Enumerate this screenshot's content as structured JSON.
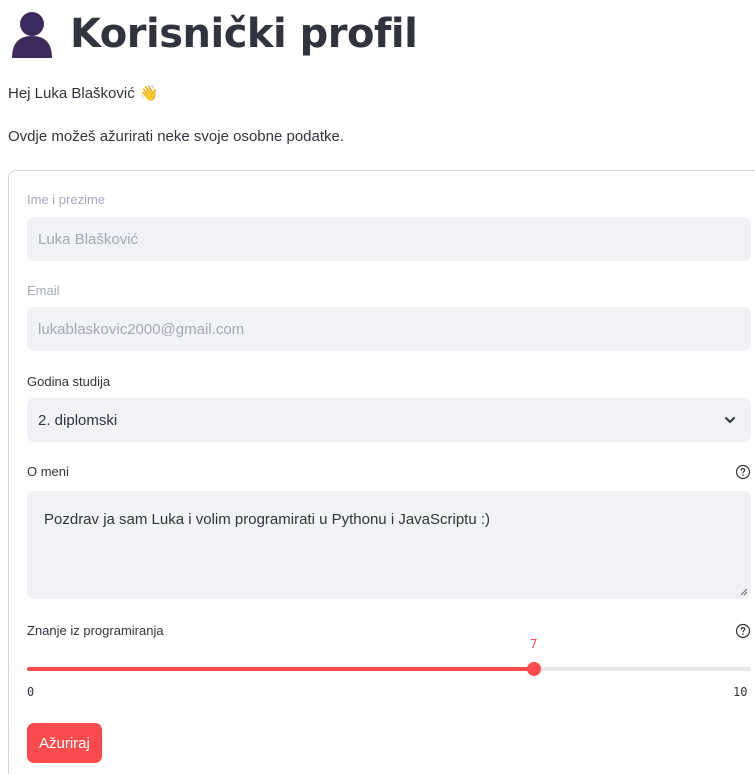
{
  "header": {
    "title": "Korisnički profil",
    "icon": "person-silhouette-icon"
  },
  "greeting": {
    "text": "Hej Luka Blašković",
    "emoji": "👋"
  },
  "intro": "Ovdje možeš ažurirati neke svoje osobne podatke.",
  "form": {
    "name": {
      "label": "Ime i prezime",
      "value": "Luka Blašković",
      "disabled": true
    },
    "email": {
      "label": "Email",
      "value": "lukablaskovic2000@gmail.com",
      "disabled": true
    },
    "year": {
      "label": "Godina studija",
      "selected": "2. diplomski"
    },
    "about": {
      "label": "O meni",
      "value": "Pozdrav ja sam Luka i volim programirati u Pythonu i JavaScriptu :)"
    },
    "skill": {
      "label": "Znanje iz programiranja",
      "value": 7,
      "min": 0,
      "max": 10,
      "value_text": "7",
      "min_text": "0",
      "max_text": "10"
    },
    "submit_label": "Ažuriraj"
  },
  "colors": {
    "accent": "#ff4b4b",
    "input_bg": "#f0f2f6",
    "text": "#31333f",
    "disabled_text": "#a3a8b4"
  }
}
